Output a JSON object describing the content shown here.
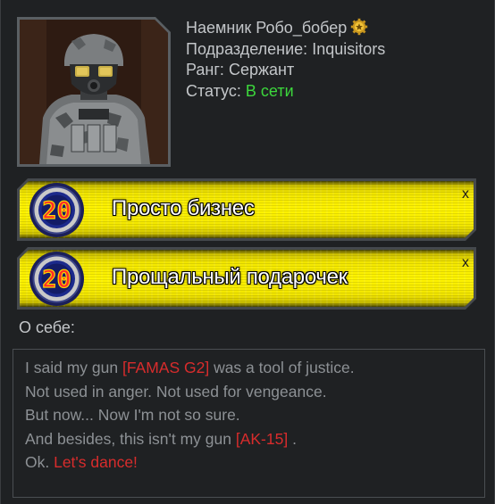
{
  "profile": {
    "name": "Наемник Робо_бобер",
    "rank_icon": "gold-rank-gear-icon",
    "division_label": "Подразделение:",
    "division_value": "Inquisitors",
    "rank_label": "Ранг:",
    "rank_value": "Сержант",
    "status_label": "Статус:",
    "status_value": "В сети",
    "status_color": "#3cd73c"
  },
  "achievements": [
    {
      "badge_number": "20",
      "title": "Просто бизнес",
      "close": "x"
    },
    {
      "badge_number": "20",
      "title": "Прощальный подарочек",
      "close": "x"
    }
  ],
  "about": {
    "label": "О себе:",
    "line1": {
      "before": "I said my gun ",
      "link": "[FAMAS G2]",
      "after": "  was a tool of justice."
    },
    "line2": "Not used in anger. Not used for vengeance.",
    "line3": "But now...  Now I'm not so sure.",
    "line4": {
      "before": "And besides, this isn't my gun ",
      "link": "[AK-15]",
      "after": " ."
    },
    "line5": {
      "before": "Ok. ",
      "highlight": "Let's dance!"
    }
  },
  "colors": {
    "background": "#1f2123",
    "text": "#c3c6c9",
    "muted_text": "#8d9195",
    "highlight_red": "#d82c2c",
    "banner_yellow": "#fff400"
  }
}
